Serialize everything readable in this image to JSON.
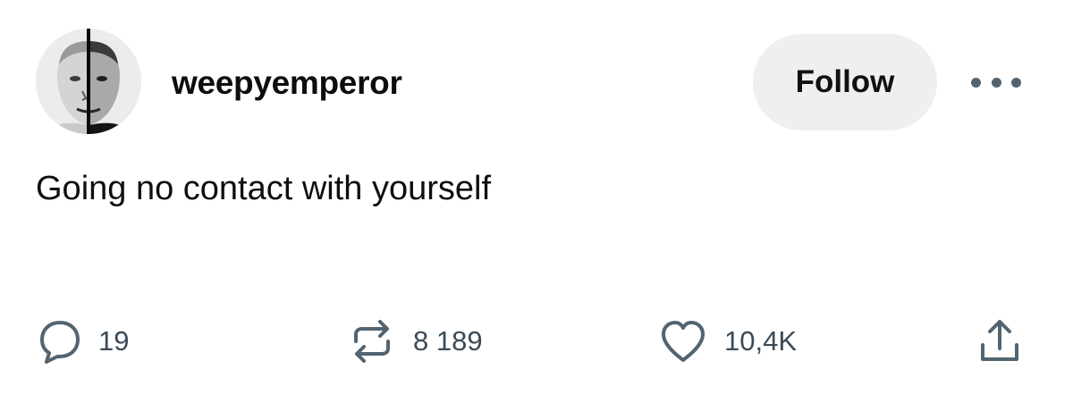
{
  "post": {
    "username": "weepyemperor",
    "follow_label": "Follow",
    "text": "Going no contact with yourself",
    "stats": {
      "replies": "19",
      "reposts": "8 189",
      "likes": "10,4K"
    }
  },
  "icons": {
    "reply": "speech-bubble-icon",
    "repost": "repost-arrows-icon",
    "like": "heart-icon",
    "share": "share-upload-icon",
    "more": "more-dots-icon"
  },
  "colors": {
    "icon": "#536471",
    "follow_bg": "#efefef",
    "text": "#0f0f0f"
  }
}
